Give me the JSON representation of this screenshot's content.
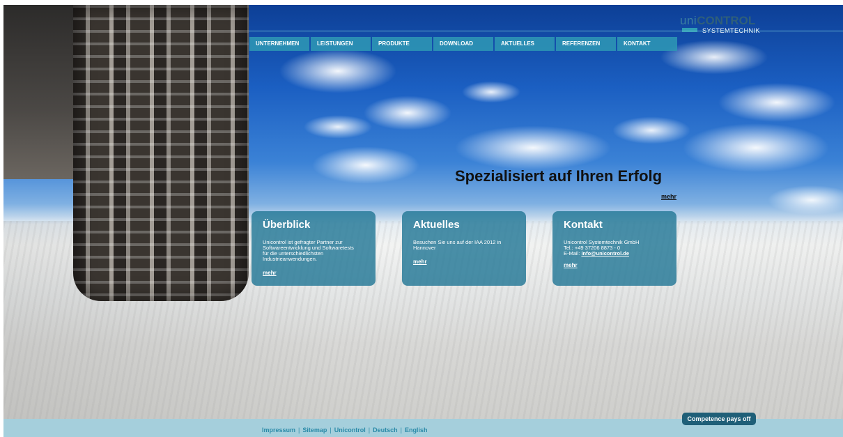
{
  "brand": {
    "logo_uni": "uni",
    "logo_control": "CONTROL",
    "logo_sub": "SYSTEMTECHNIK"
  },
  "nav": {
    "items": [
      "UNTERNEHMEN",
      "LEISTUNGEN",
      "PRODUKTE",
      "DOWNLOAD",
      "AKTUELLES",
      "REFERENZEN",
      "KONTAKT"
    ]
  },
  "hero": {
    "headline": "Spezialisiert auf Ihren Erfolg",
    "more": "mehr"
  },
  "boxes": [
    {
      "title": "Überblick",
      "text": "Unicontrol ist gefragter Partner zur Softwareentwicklung und Softwaretests für die unterschiedlichsten Industrieanwendungen.",
      "more": "mehr"
    },
    {
      "title": "Aktuelles",
      "text": "Besuchen Sie uns auf der IAA 2012 in Hannover",
      "more": "mehr"
    },
    {
      "title": "Kontakt",
      "company": "Unicontrol Systemtechnik GmbH",
      "phone": "Tel.: +49 37206 8873 - 0",
      "email_label": "E-Mail:",
      "email": "info@unicontrol.de",
      "more": "mehr"
    }
  ],
  "badge": "Competence pays off",
  "footer": {
    "links": [
      "Impressum",
      "Sitemap",
      "Unicontrol",
      "Deutsch",
      "English"
    ],
    "separator": "|"
  },
  "colors": {
    "accent": "#2d96b4",
    "box_bg": "#2378a0",
    "footer_bg": "#a5cfdc",
    "badge_bg": "#1f5f78"
  }
}
